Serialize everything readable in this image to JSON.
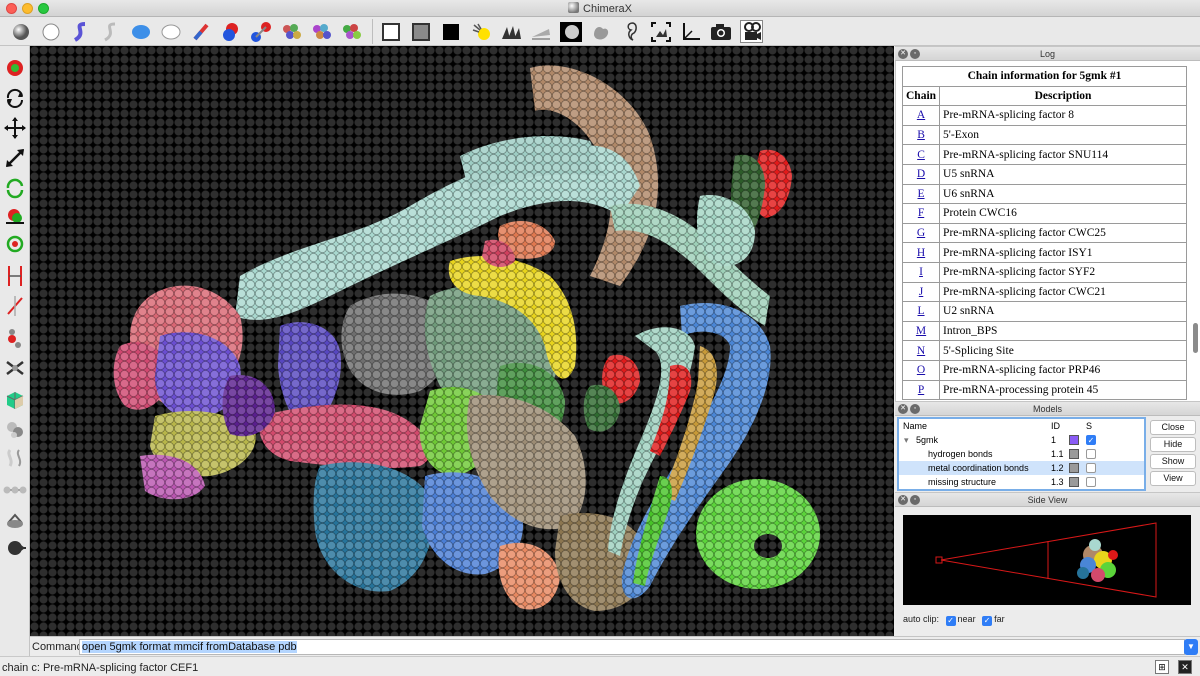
{
  "window": {
    "title": "ChimeraX"
  },
  "command": {
    "label": "Command:",
    "value": "open 5gmk format mmcif fromDatabase pdb"
  },
  "status": {
    "text": "chain c: Pre-mRNA-splicing factor CEF1"
  },
  "log": {
    "panel_title": "Log",
    "table_title": "Chain information for 5gmk #1",
    "col_chain": "Chain",
    "col_desc": "Description",
    "rows": [
      {
        "chain": "A",
        "desc": "Pre-mRNA-splicing factor 8"
      },
      {
        "chain": "B",
        "desc": "5'-Exon"
      },
      {
        "chain": "C",
        "desc": "Pre-mRNA-splicing factor SNU114"
      },
      {
        "chain": "D",
        "desc": "U5 snRNA"
      },
      {
        "chain": "E",
        "desc": "U6 snRNA"
      },
      {
        "chain": "F",
        "desc": "Protein CWC16"
      },
      {
        "chain": "G",
        "desc": "Pre-mRNA-splicing factor CWC25"
      },
      {
        "chain": "H",
        "desc": "Pre-mRNA-splicing factor ISY1"
      },
      {
        "chain": "I",
        "desc": "Pre-mRNA-splicing factor SYF2"
      },
      {
        "chain": "J",
        "desc": "Pre-mRNA-splicing factor CWC21"
      },
      {
        "chain": "L",
        "desc": "U2 snRNA"
      },
      {
        "chain": "M",
        "desc": "Intron_BPS"
      },
      {
        "chain": "N",
        "desc": "5'-Splicing Site"
      },
      {
        "chain": "O",
        "desc": "Pre-mRNA-splicing factor PRP46"
      },
      {
        "chain": "P",
        "desc": "Pre-mRNA-processing protein 45"
      }
    ]
  },
  "models": {
    "panel_title": "Models",
    "col_name": "Name",
    "col_id": "ID",
    "col_s": "S",
    "rows": [
      {
        "name": "5gmk",
        "id": "1",
        "color": "#8a5cf5",
        "shown": true
      },
      {
        "name": "hydrogen bonds",
        "id": "1.1",
        "color": "#9a9a9a",
        "shown": false
      },
      {
        "name": "metal coordination bonds",
        "id": "1.2",
        "color": "#9a9a9a",
        "shown": false
      },
      {
        "name": "missing structure",
        "id": "1.3",
        "color": "#9a9a9a",
        "shown": false
      }
    ],
    "buttons": {
      "close": "Close",
      "hide": "Hide",
      "show": "Show",
      "view": "View"
    }
  },
  "side_view": {
    "panel_title": "Side View",
    "autoclip_label": "auto clip:",
    "near_label": "near",
    "far_label": "far"
  },
  "colors": {
    "accent": "#2f7df6",
    "selection": "#b4d5fe"
  }
}
